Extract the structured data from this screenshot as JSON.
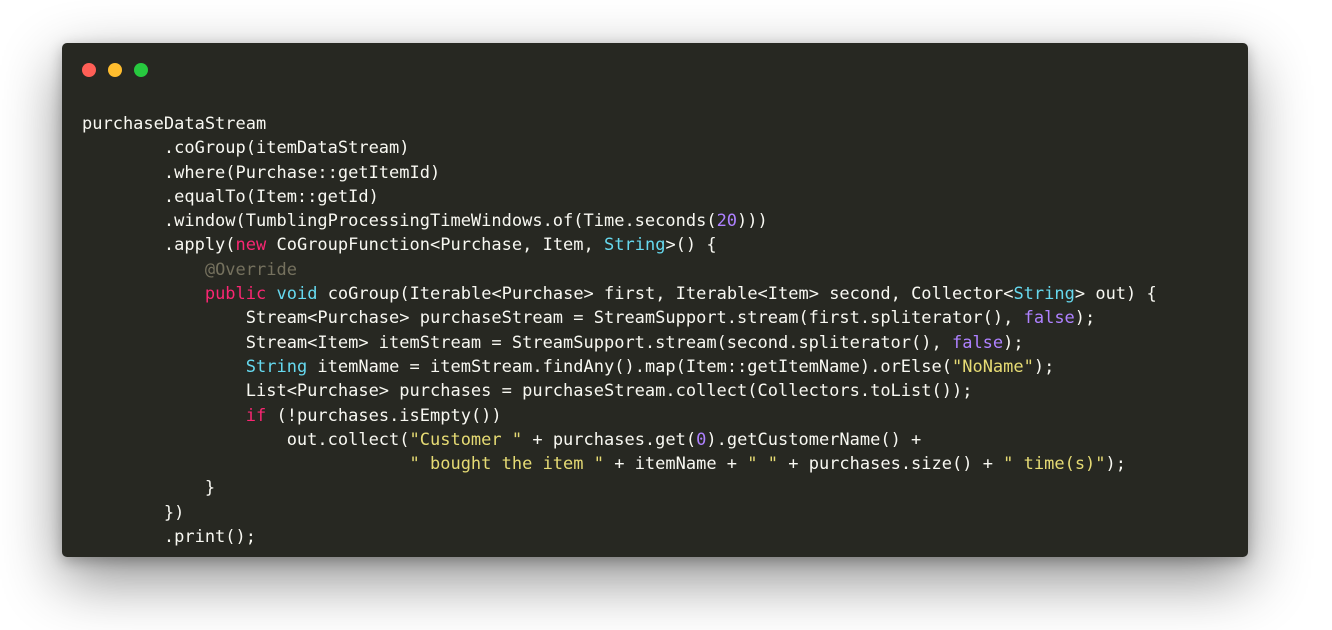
{
  "window": {
    "controls": [
      {
        "name": "close",
        "color": "#ff5f56"
      },
      {
        "name": "minimize",
        "color": "#ffbd2e"
      },
      {
        "name": "zoom",
        "color": "#27c93f"
      }
    ]
  },
  "code": {
    "lines": [
      [
        {
          "t": "plain",
          "v": "purchaseDataStream"
        }
      ],
      [
        {
          "t": "plain",
          "v": "        .coGroup(itemDataStream)"
        }
      ],
      [
        {
          "t": "plain",
          "v": "        .where(Purchase::getItemId)"
        }
      ],
      [
        {
          "t": "plain",
          "v": "        .equalTo(Item::getId)"
        }
      ],
      [
        {
          "t": "plain",
          "v": "        .window(TumblingProcessingTimeWindows.of(Time.seconds("
        },
        {
          "t": "num",
          "v": "20"
        },
        {
          "t": "plain",
          "v": ")))"
        }
      ],
      [
        {
          "t": "plain",
          "v": "        .apply("
        },
        {
          "t": "kw",
          "v": "new"
        },
        {
          "t": "plain",
          "v": " CoGroupFunction<Purchase, Item, "
        },
        {
          "t": "type",
          "v": "String"
        },
        {
          "t": "plain",
          "v": ">() {"
        }
      ],
      [
        {
          "t": "plain",
          "v": "            "
        },
        {
          "t": "ann",
          "v": "@Override"
        }
      ],
      [
        {
          "t": "plain",
          "v": "            "
        },
        {
          "t": "kw",
          "v": "public"
        },
        {
          "t": "plain",
          "v": " "
        },
        {
          "t": "type",
          "v": "void"
        },
        {
          "t": "plain",
          "v": " coGroup(Iterable<Purchase> first, Iterable<Item> second, Collector<"
        },
        {
          "t": "type",
          "v": "String"
        },
        {
          "t": "plain",
          "v": "> out) {"
        }
      ],
      [
        {
          "t": "plain",
          "v": "                Stream<Purchase> purchaseStream = StreamSupport.stream(first.spliterator(), "
        },
        {
          "t": "bool",
          "v": "false"
        },
        {
          "t": "plain",
          "v": ");"
        }
      ],
      [
        {
          "t": "plain",
          "v": "                Stream<Item> itemStream = StreamSupport.stream(second.spliterator(), "
        },
        {
          "t": "bool",
          "v": "false"
        },
        {
          "t": "plain",
          "v": ");"
        }
      ],
      [
        {
          "t": "plain",
          "v": "                "
        },
        {
          "t": "type",
          "v": "String"
        },
        {
          "t": "plain",
          "v": " itemName = itemStream.findAny().map(Item::getItemName).orElse("
        },
        {
          "t": "str",
          "v": "\"NoName\""
        },
        {
          "t": "plain",
          "v": ");"
        }
      ],
      [
        {
          "t": "plain",
          "v": "                List<Purchase> purchases = purchaseStream.collect(Collectors.toList());"
        }
      ],
      [
        {
          "t": "plain",
          "v": "                "
        },
        {
          "t": "kw",
          "v": "if"
        },
        {
          "t": "plain",
          "v": " (!purchases.isEmpty())"
        }
      ],
      [
        {
          "t": "plain",
          "v": "                    out.collect("
        },
        {
          "t": "str",
          "v": "\"Customer \""
        },
        {
          "t": "plain",
          "v": " + purchases.get("
        },
        {
          "t": "num",
          "v": "0"
        },
        {
          "t": "plain",
          "v": ").getCustomerName() +"
        }
      ],
      [
        {
          "t": "plain",
          "v": "                                "
        },
        {
          "t": "str",
          "v": "\" bought the item \""
        },
        {
          "t": "plain",
          "v": " + itemName + "
        },
        {
          "t": "str",
          "v": "\" \""
        },
        {
          "t": "plain",
          "v": " + purchases.size() + "
        },
        {
          "t": "str",
          "v": "\" time(s)\""
        },
        {
          "t": "plain",
          "v": ");"
        }
      ],
      [
        {
          "t": "plain",
          "v": "            }"
        }
      ],
      [
        {
          "t": "plain",
          "v": "        })"
        }
      ],
      [
        {
          "t": "plain",
          "v": "        .print();"
        }
      ]
    ]
  }
}
